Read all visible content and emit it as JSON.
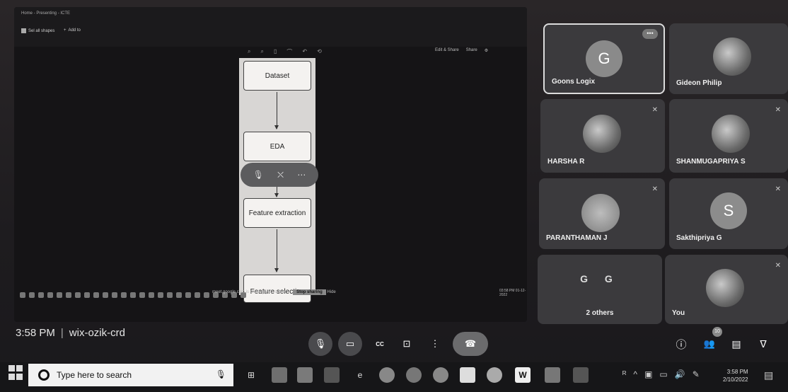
{
  "share": {
    "title": "Home - Presenting - ICTE",
    "btn_sel": "Sel all shapes",
    "btn_add": "Add to",
    "tools": [
      "⌕",
      "⌕",
      "▯",
      "⌒",
      "↶",
      "⟲"
    ],
    "right": [
      "Edit & Share",
      "Share",
      "⚙"
    ],
    "flow": [
      "Dataset",
      "EDA",
      "Feature extraction",
      "Feature selection"
    ],
    "pill_icons": [
      "🎙",
      "⛌",
      "⋯"
    ],
    "notice": "meet.google.com is sharing your screen.",
    "notice_btn": "Stop sharing",
    "notice_hide": "Hide",
    "inner_clock": "03:58 PM 01-12-2022"
  },
  "tiles": [
    {
      "name": "Goons Logix",
      "letter": "G",
      "color": "#8a8a8a"
    },
    {
      "name": "Gideon Philip"
    },
    {
      "name": "HARSHA R"
    },
    {
      "name": "SHANMUGAPRIYA S"
    },
    {
      "name": "PARANTHAMAN J"
    },
    {
      "name": "Sakthipriya G",
      "letter": "S",
      "color": "#8c8c8c"
    },
    {
      "name": "2 others",
      "letters": "G G"
    },
    {
      "name": "You"
    }
  ],
  "meeting": {
    "time": "3:58 PM",
    "sep": "|",
    "code": "wix-ozik-crd"
  },
  "controls": {
    "mic": "🎙",
    "cam": "▭",
    "cc": "CC",
    "present": "⊡",
    "more": "⋮",
    "end": "☎"
  },
  "right_controls": {
    "info": "ⓘ",
    "people": "👥",
    "chat": "▤",
    "activities": "ᐁ",
    "people_count": "10"
  },
  "taskbar": {
    "search_placeholder": "Type here to search",
    "mic": "🎙",
    "time": "3:58 PM",
    "date": "2/10/2022",
    "tray": [
      "ᴿ",
      "^",
      "▣",
      "▭",
      "🔊",
      "✎"
    ],
    "notif": "▤"
  }
}
